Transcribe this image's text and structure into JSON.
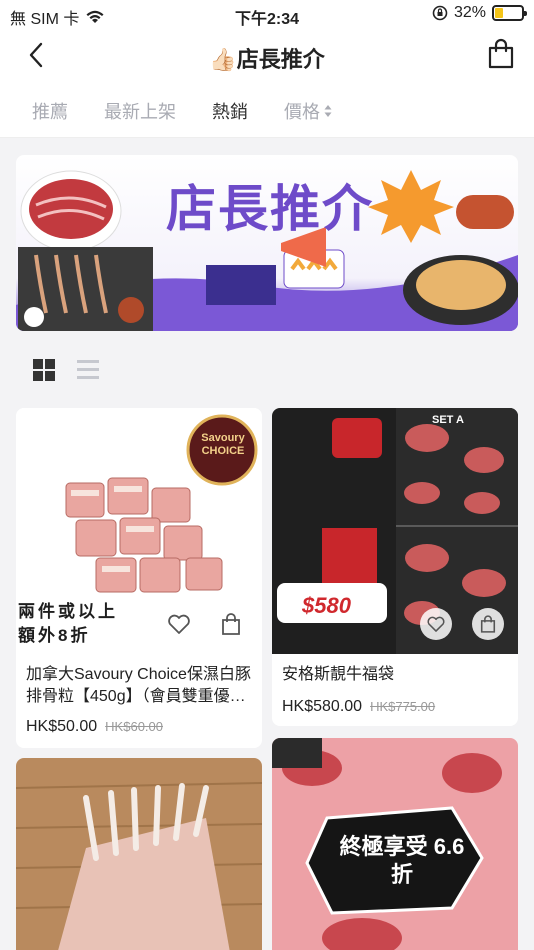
{
  "status": {
    "carrier": "無 SIM 卡",
    "time": "下午2:34",
    "battery_text": "32%",
    "battery_level": 0.32
  },
  "nav": {
    "title": "店長推介",
    "title_emoji": "👍🏻"
  },
  "tabs": [
    {
      "label": "推薦"
    },
    {
      "label": "最新上架"
    },
    {
      "label": "熱銷"
    },
    {
      "label": "價格"
    }
  ],
  "banner": {
    "title": "店長推介"
  },
  "products": [
    {
      "name": "加拿大Savoury Choice保濕白豚排骨粒【450g】（會員雙重優…",
      "price": "HK$50.00",
      "old_price": "HK$60.00",
      "promo": "兩件或以上額外8折",
      "brand": "Savoury CHOICE"
    },
    {
      "name": "安格斯靚牛福袋",
      "price": "HK$580.00",
      "old_price": "HK$775.00",
      "promo": "$580",
      "brand": "SET A"
    },
    {
      "name": "",
      "price": "",
      "old_price": ""
    },
    {
      "name": "",
      "price": "",
      "old_price": "",
      "promo": "終極享受 6.6折"
    }
  ]
}
